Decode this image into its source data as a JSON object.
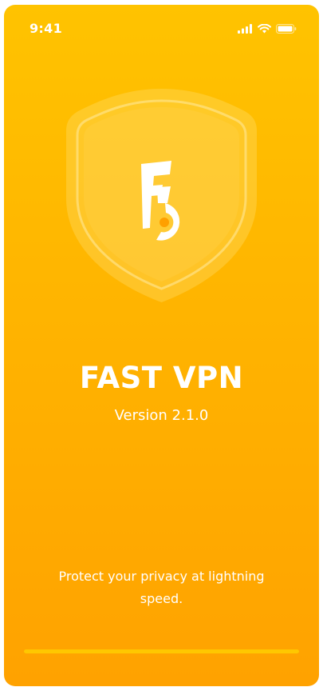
{
  "status_bar": {
    "time": "9:41",
    "icons": [
      "signal-icon",
      "wifi-icon",
      "battery-icon"
    ]
  },
  "brand": {
    "logo_icon": "fast-vpn-shield-logo-icon",
    "logo_text": "F5"
  },
  "app": {
    "title": "FAST VPN",
    "version": "Version 2.1.0",
    "tagline": "Protect your privacy at lightning speed."
  },
  "loading": {
    "progress": 1.0
  },
  "colors": {
    "gradient_top": "#FFC300",
    "gradient_bottom": "#FFA200",
    "text": "#FFFFFF",
    "accent_dot": "#FFA000"
  }
}
